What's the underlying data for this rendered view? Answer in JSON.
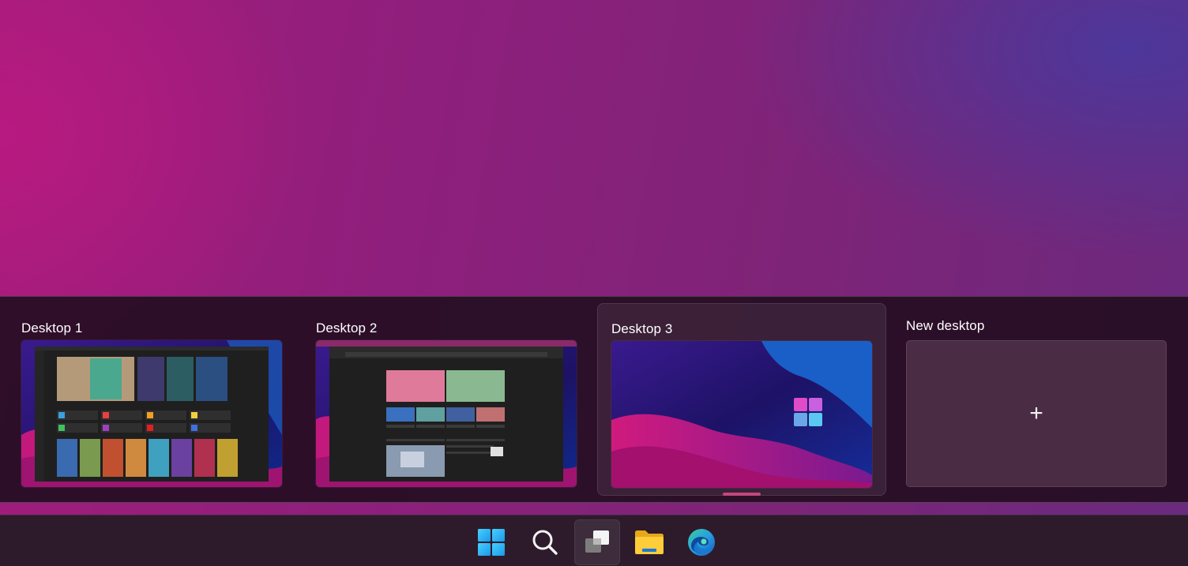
{
  "desktops": [
    {
      "label": "Desktop 1",
      "active": false
    },
    {
      "label": "Desktop 2",
      "active": false
    },
    {
      "label": "Desktop 3",
      "active": true
    }
  ],
  "new_desktop": {
    "label": "New desktop",
    "symbol": "+"
  },
  "taskbar": {
    "items": [
      {
        "name": "start",
        "icon": "windows-logo-icon"
      },
      {
        "name": "search",
        "icon": "search-icon"
      },
      {
        "name": "task-view",
        "icon": "task-view-icon",
        "pressed": true
      },
      {
        "name": "file-explorer",
        "icon": "folder-icon"
      },
      {
        "name": "edge",
        "icon": "edge-icon"
      }
    ]
  },
  "colors": {
    "panel": "#260e24",
    "indicator": "#c2477e",
    "taskbar": "#2d1b2c",
    "windows_blue": "#2fb7f0"
  }
}
